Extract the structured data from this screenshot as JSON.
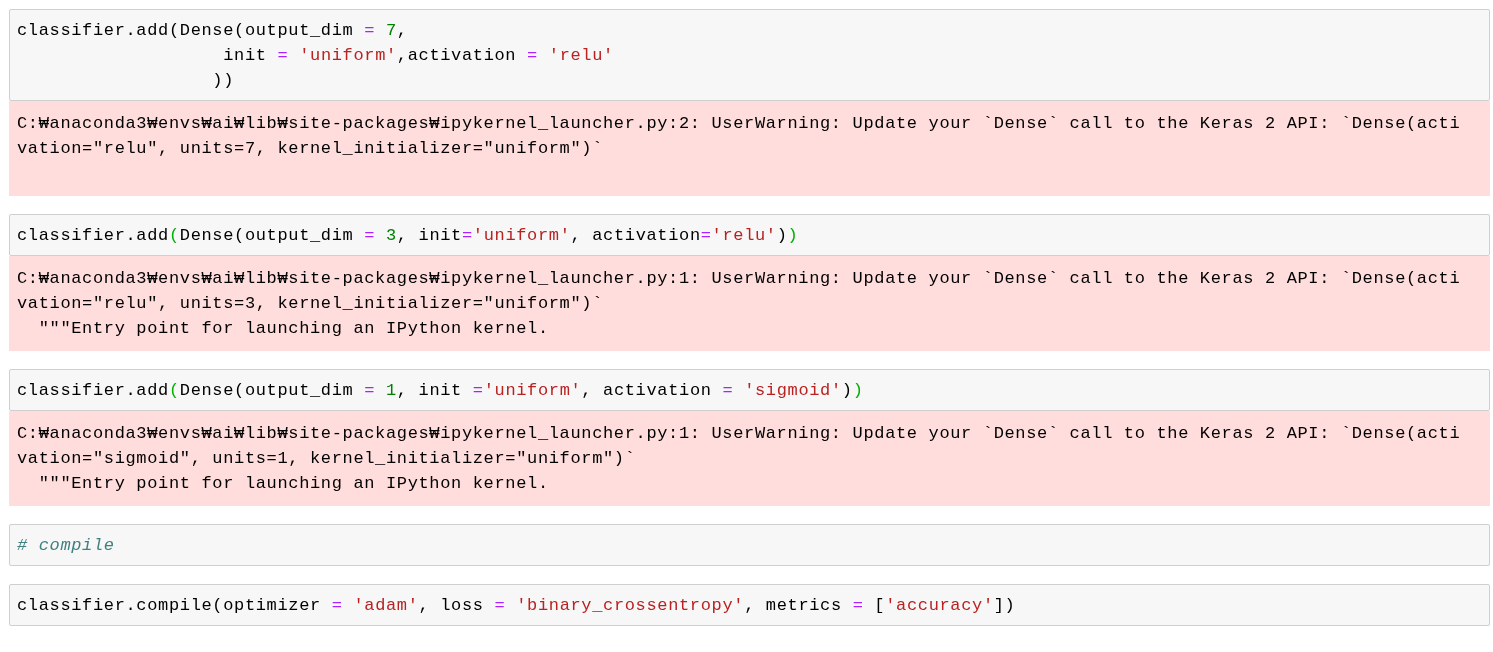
{
  "cells": [
    {
      "input": [
        "classifier.add(Dense(output_dim = 7,",
        "                   init = 'uniform',activation = 'relu'",
        "                  ))"
      ],
      "bracket_highlight": false,
      "output": [
        "C:₩anaconda3₩envs₩ai₩lib₩site-packages₩ipykernel_launcher.py:2: UserWarning: Update your `Dense` call to the Keras 2 API: `Dense(acti",
        "vation=\"relu\", units=7, kernel_initializer=\"uniform\")`"
      ]
    },
    {
      "input": [
        "classifier.add(Dense(output_dim = 3, init='uniform', activation='relu'))"
      ],
      "bracket_highlight": true,
      "output": [
        "C:₩anaconda3₩envs₩ai₩lib₩site-packages₩ipykernel_launcher.py:1: UserWarning: Update your `Dense` call to the Keras 2 API: `Dense(acti",
        "vation=\"relu\", units=3, kernel_initializer=\"uniform\")`",
        "  \"\"\"Entry point for launching an IPython kernel."
      ]
    },
    {
      "input": [
        "classifier.add(Dense(output_dim = 1, init ='uniform', activation = 'sigmoid'))"
      ],
      "bracket_highlight": true,
      "output": [
        "C:₩anaconda3₩envs₩ai₩lib₩site-packages₩ipykernel_launcher.py:1: UserWarning: Update your `Dense` call to the Keras 2 API: `Dense(acti",
        "vation=\"sigmoid\", units=1, kernel_initializer=\"uniform\")`",
        "  \"\"\"Entry point for launching an IPython kernel."
      ]
    },
    {
      "input": [
        "# compile"
      ]
    },
    {
      "input": [
        "classifier.compile(optimizer = 'adam', loss = 'binary_crossentropy', metrics = ['accuracy'])"
      ],
      "bracket_highlight": false
    }
  ]
}
